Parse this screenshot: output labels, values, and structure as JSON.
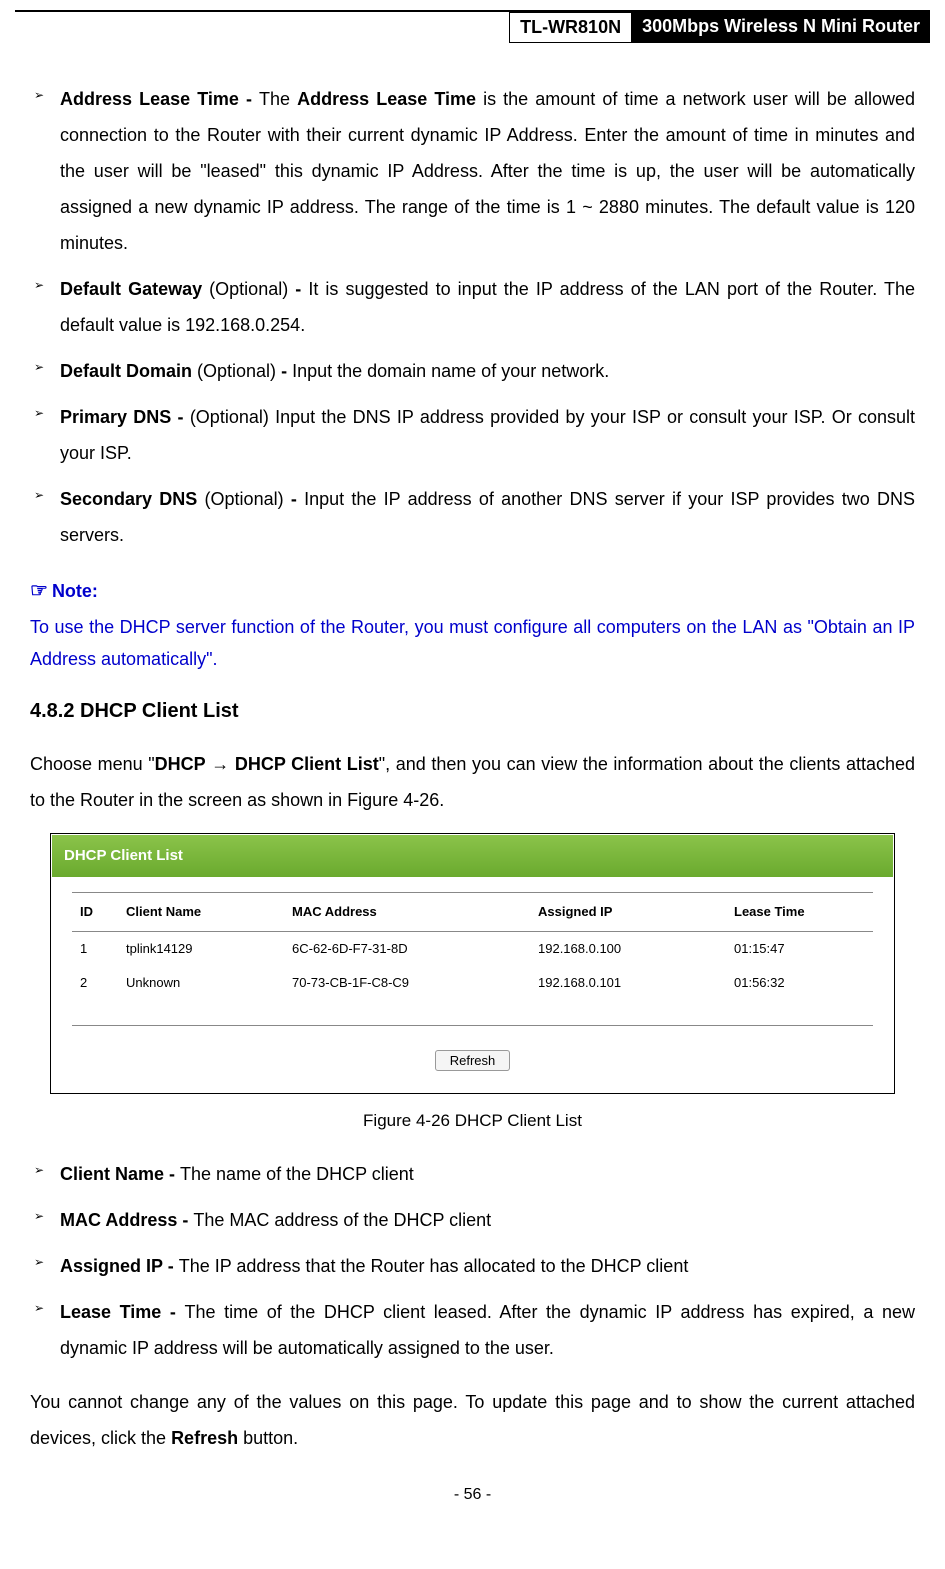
{
  "header": {
    "model": "TL-WR810N",
    "product_title": "300Mbps Wireless N Mini Router"
  },
  "items_top": [
    {
      "label": "Address Lease Time - ",
      "desc_prefix": "The ",
      "desc_bold": "Address Lease Time",
      "desc_suffix": " is the amount of time a network user will be allowed connection to the Router with their current dynamic IP Address. Enter the amount of time in minutes and the user will be \"leased\" this dynamic IP Address. After the time is up, the user will be automatically assigned a new dynamic IP address. The range of the time is 1 ~ 2880 minutes. The default value is 120 minutes."
    },
    {
      "label": "Default Gateway",
      "optional": " (Optional) ",
      "dash": "- ",
      "desc": "It is suggested to input the IP address of the LAN port of the Router. The default value is 192.168.0.254."
    },
    {
      "label": "Default Domain",
      "optional": " (Optional) ",
      "dash": "- ",
      "desc": "Input the domain name of your network."
    },
    {
      "label": "Primary DNS - ",
      "desc": "(Optional) Input the DNS IP address provided by your ISP or consult your ISP. Or consult your ISP."
    },
    {
      "label": "Secondary DNS",
      "optional": " (Optional) ",
      "dash": "- ",
      "desc": "Input the IP address of another DNS server if your ISP provides two DNS servers."
    }
  ],
  "note": {
    "title": "Note:",
    "text": "To use the DHCP server function of the Router, you must configure all computers on the LAN as \"Obtain an IP Address automatically\"."
  },
  "section": {
    "heading": "4.8.2  DHCP Client List",
    "intro_prefix": "Choose menu \"",
    "intro_bold1": "DHCP",
    "intro_arrow": " → ",
    "intro_bold2": "DHCP Client List",
    "intro_suffix": "\", and then you can view the information about the clients attached to the Router in the screen as shown in Figure 4-26."
  },
  "figure": {
    "panel_title": "DHCP Client List",
    "columns": {
      "id": "ID",
      "client_name": "Client Name",
      "mac": "MAC Address",
      "ip": "Assigned IP",
      "lease": "Lease Time"
    },
    "rows": [
      {
        "id": "1",
        "name": "tplink14129",
        "mac": "6C-62-6D-F7-31-8D",
        "ip": "192.168.0.100",
        "lease": "01:15:47"
      },
      {
        "id": "2",
        "name": "Unknown",
        "mac": "70-73-CB-1F-C8-C9",
        "ip": "192.168.0.101",
        "lease": "01:56:32"
      }
    ],
    "refresh": "Refresh",
    "caption": "Figure 4-26 DHCP Client List"
  },
  "items_bottom": [
    {
      "label": "Client Name - ",
      "desc": "The name of the DHCP client"
    },
    {
      "label": "MAC Address - ",
      "desc": "The MAC address of the DHCP client"
    },
    {
      "label": "Assigned IP - ",
      "desc": "The IP address that the Router has allocated to the DHCP client"
    },
    {
      "label": "Lease Time - ",
      "desc": "The time of the DHCP client leased. After the dynamic IP address has expired, a new dynamic IP address will be automatically assigned to the user."
    }
  ],
  "closing": {
    "prefix": "You cannot change any of the values on this page. To update this page and to show the current attached devices, click the ",
    "bold": "Refresh",
    "suffix": " button."
  },
  "page_number": "- 56 -"
}
